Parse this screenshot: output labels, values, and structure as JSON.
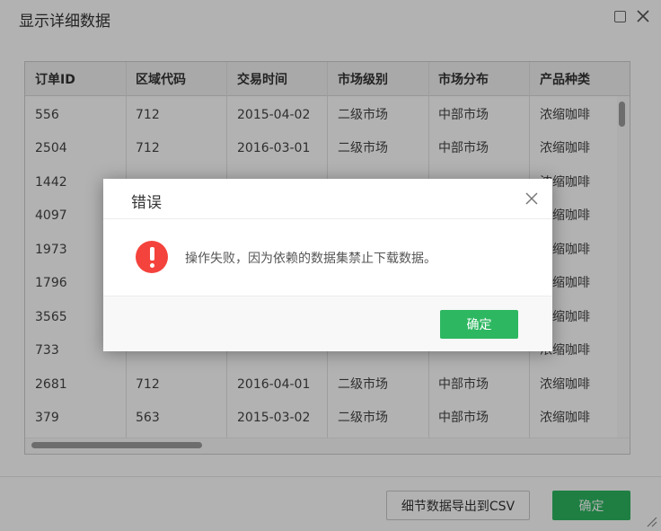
{
  "outer": {
    "title": "显示详细数据",
    "csv_button": "细节数据导出到CSV",
    "confirm_button": "确定"
  },
  "table": {
    "columns": [
      "订单ID",
      "区域代码",
      "交易时间",
      "市场级别",
      "市场分布",
      "产品种类"
    ],
    "rows": [
      [
        "556",
        "712",
        "2015-04-02",
        "二级市场",
        "中部市场",
        "浓缩咖啡"
      ],
      [
        "2504",
        "712",
        "2016-03-01",
        "二级市场",
        "中部市场",
        "浓缩咖啡"
      ],
      [
        "1442",
        "",
        "",
        "",
        "",
        "浓缩咖啡"
      ],
      [
        "4097",
        "",
        "",
        "",
        "",
        "浓缩咖啡"
      ],
      [
        "1973",
        "",
        "",
        "",
        "",
        "浓缩咖啡"
      ],
      [
        "1796",
        "",
        "",
        "",
        "",
        "浓缩咖啡"
      ],
      [
        "3565",
        "",
        "",
        "",
        "",
        "浓缩咖啡"
      ],
      [
        "733",
        "",
        "",
        "",
        "",
        "浓缩咖啡"
      ],
      [
        "2681",
        "712",
        "2016-04-01",
        "二级市场",
        "中部市场",
        "浓缩咖啡"
      ],
      [
        "379",
        "563",
        "2015-03-02",
        "二级市场",
        "中部市场",
        "浓缩咖啡"
      ]
    ]
  },
  "modal": {
    "title": "错误",
    "message": "操作失败，因为依赖的数据集禁止下载数据。",
    "confirm_button": "确定",
    "error_color": "#f4433c",
    "accent_color": "#2db761"
  }
}
